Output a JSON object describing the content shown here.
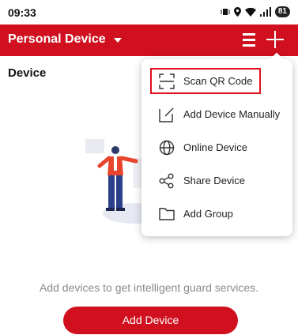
{
  "status_bar": {
    "time": "09:33",
    "battery": "81"
  },
  "app_bar": {
    "title": "Personal Device"
  },
  "section": {
    "title": "Device"
  },
  "empty_state": {
    "message": "Add devices to get intelligent guard services.",
    "button_label": "Add Device"
  },
  "menu": {
    "items": [
      {
        "label": "Scan QR Code",
        "icon": "scan-qr-icon"
      },
      {
        "label": "Add Device Manually",
        "icon": "edit-icon"
      },
      {
        "label": "Online Device",
        "icon": "globe-icon"
      },
      {
        "label": "Share Device",
        "icon": "share-icon"
      },
      {
        "label": "Add Group",
        "icon": "folder-icon"
      }
    ]
  },
  "colors": {
    "brand_red": "#d0101e",
    "highlight_red": "#e01020"
  }
}
